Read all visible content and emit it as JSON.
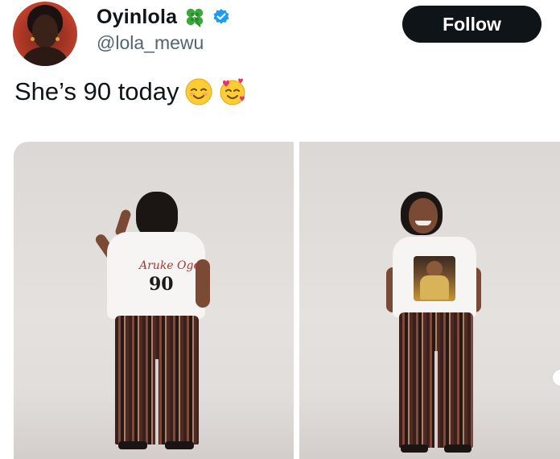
{
  "tweet": {
    "display_name": "Oyinlola",
    "handle": "@lola_mewu",
    "follow_label": "Follow",
    "text": "She’s 90 today",
    "emoji_names": [
      "relieved-smiling-face-emoji",
      "smiling-face-with-hearts-emoji"
    ],
    "name_badges": [
      "four-leaf-clover-icon",
      "verified-badge-icon"
    ],
    "colors": {
      "verified_blue": "#1d9bf0",
      "follow_bg": "#0f1419",
      "handle_grey": "#536471"
    }
  },
  "media": {
    "left_shirt_script": "Aruke Oge",
    "left_shirt_number": "90"
  }
}
